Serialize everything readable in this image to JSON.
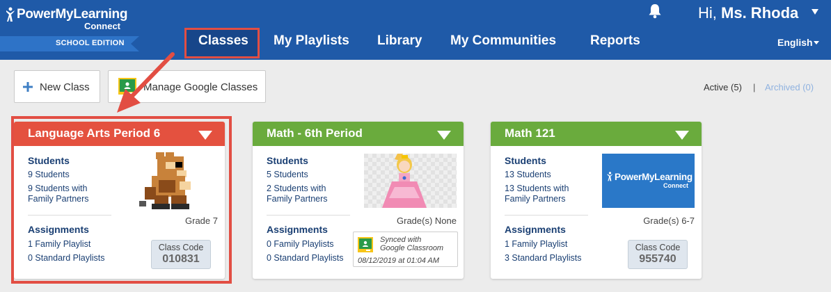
{
  "brand": {
    "name": "PowerMyLearning",
    "sub": "Connect",
    "edition": "SCHOOL EDITION"
  },
  "user": {
    "greeting_prefix": "Hi,",
    "name": "Ms. Rhoda"
  },
  "nav": {
    "items": [
      "Classes",
      "My Playlists",
      "Library",
      "My Communities",
      "Reports"
    ],
    "active": "Classes",
    "language": "English"
  },
  "toolbar": {
    "new_class": "New Class",
    "manage_google": "Manage Google Classes",
    "active_filter": "Active (5)",
    "separator": "|",
    "archived_filter": "Archived (0)"
  },
  "colors": {
    "header": "#1f5aa8",
    "card_red": "#e4513f",
    "card_green": "#6aab3d",
    "highlight": "#e24e43"
  },
  "cards": [
    {
      "title": "Language Arts Period 6",
      "students_label": "Students",
      "students": "9 Students",
      "family": "9 Students with Family Partners",
      "grade": "Grade 7",
      "assignments_label": "Assignments",
      "family_playlists": "1 Family Playlist",
      "standard_playlists": "0 Standard Playlists",
      "code_label": "Class Code",
      "code": "010831",
      "image": "pixel-raccoon-mario"
    },
    {
      "title": "Math - 6th Period",
      "students_label": "Students",
      "students": "5 Students",
      "family": "2 Students with Family Partners",
      "grade": "Grade(s) None",
      "assignments_label": "Assignments",
      "family_playlists": "0 Family Playlists",
      "standard_playlists": "0 Standard Playlists",
      "sync_line1": "Synced with",
      "sync_line2": "Google Classroom",
      "sync_date": "08/12/2019 at 01:04 AM",
      "image": "princess-peach"
    },
    {
      "title": "Math 121",
      "students_label": "Students",
      "students": "13 Students",
      "family": "13 Students with Family Partners",
      "grade": "Grade(s) 6-7",
      "assignments_label": "Assignments",
      "family_playlists": "1 Family Playlist",
      "standard_playlists": "3 Standard Playlists",
      "code_label": "Class Code",
      "code": "955740",
      "image_text": "PowerMyLearning",
      "image_sub": "Connect"
    }
  ]
}
